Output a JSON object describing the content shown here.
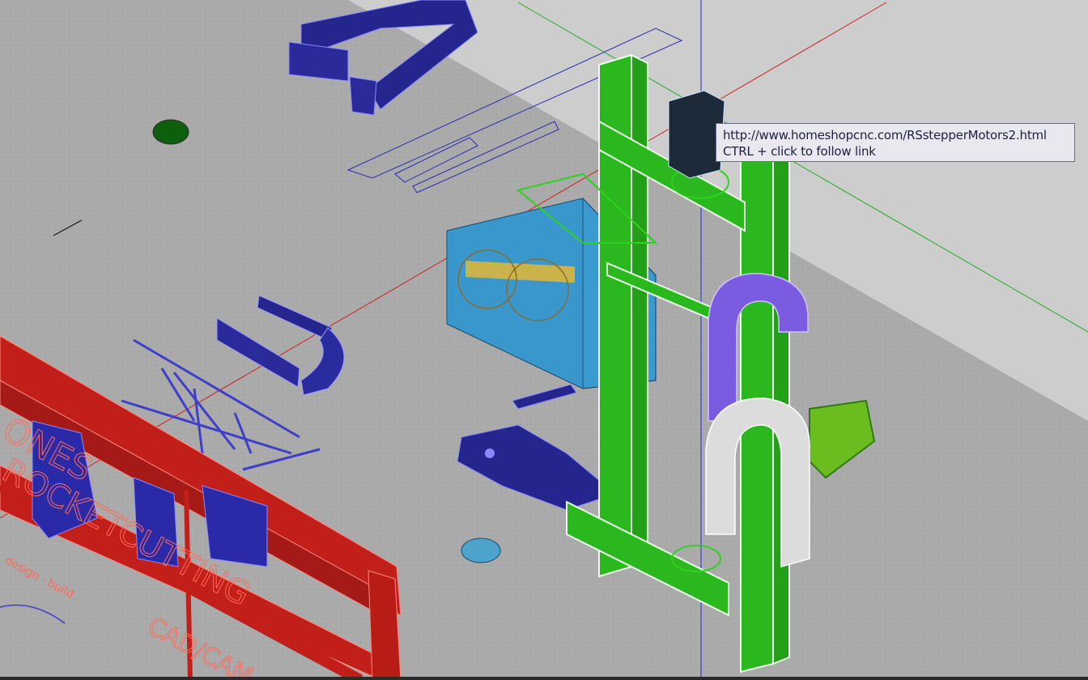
{
  "tooltip": {
    "url": "http://www.homeshopcnc.com/RSstepperMotors2.html",
    "hint": "CTRL + click to follow link"
  },
  "drawing_text": {
    "sign_line_1": "ONES",
    "sign_line_2": "ROCKETCUTTING",
    "sign_line_3": "design · build",
    "sign_line_4": "CAD/CAM"
  },
  "colors": {
    "floor": "#a9a9a9",
    "background_wall": "#c8c8c8",
    "frame_green": "#33cc22",
    "panel_navy": "#23238f",
    "part_blue": "#3a99cc",
    "cable_purple": "#7755dd",
    "chain_white": "#e4e4e4",
    "red_frame": "#c8201a",
    "axis_x": "#cc2222",
    "axis_y": "#22aa22",
    "axis_z": "#2233cc"
  }
}
